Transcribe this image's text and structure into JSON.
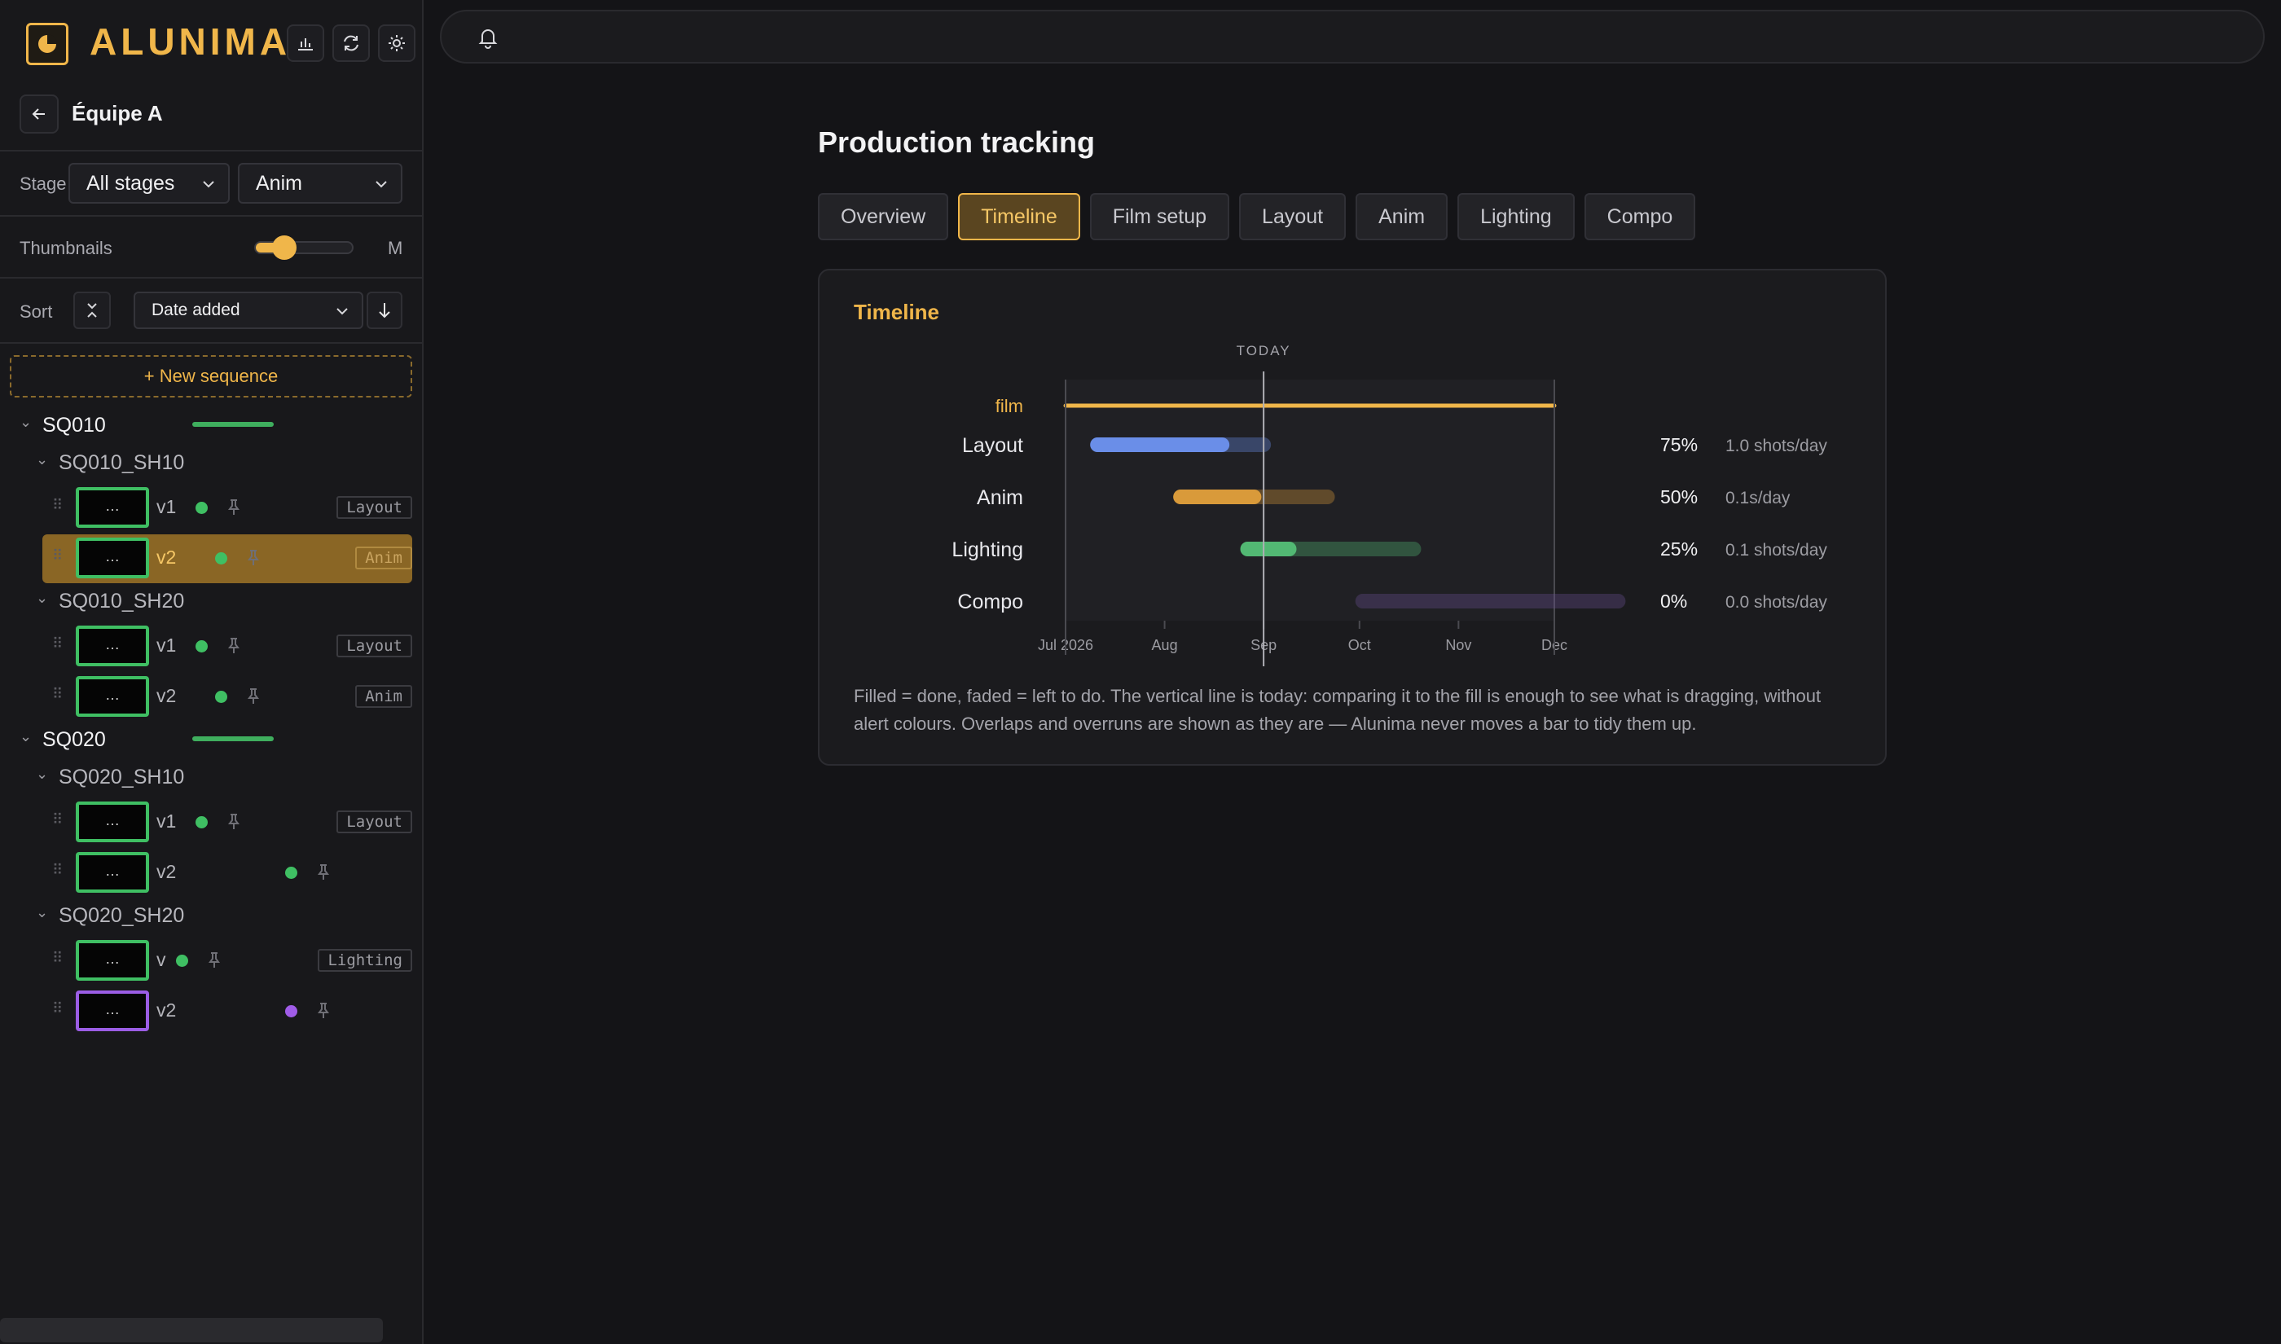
{
  "app": {
    "brand": "ALUNIMA"
  },
  "team": {
    "name": "Équipe A"
  },
  "filters": {
    "stage_label": "Stage",
    "stage_value": "All stages",
    "dept_value": "Anim"
  },
  "thumbnails": {
    "label": "Thumbnails",
    "size": "M",
    "slider_fraction": 0.3
  },
  "sort": {
    "label": "Sort",
    "value": "Date added"
  },
  "new_sequence": "+ New sequence",
  "tree": {
    "sequences": [
      {
        "name": "SQ010",
        "progress": 0.5,
        "shots": [
          {
            "name": "SQ010_SH10",
            "versions": [
              {
                "version": "v1",
                "stage": "Layout",
                "status": "green",
                "selected": false,
                "thumb": "…"
              },
              {
                "version": "v2",
                "stage": "Anim",
                "status": "green",
                "selected": true,
                "thumb": "…"
              }
            ]
          },
          {
            "name": "SQ010_SH20",
            "versions": [
              {
                "version": "v1",
                "stage": "Layout",
                "status": "green",
                "selected": false,
                "thumb": "…"
              },
              {
                "version": "v2",
                "stage": "Anim",
                "status": "green",
                "selected": false,
                "thumb": "…"
              }
            ]
          }
        ]
      },
      {
        "name": "SQ020",
        "progress": 0.5,
        "shots": [
          {
            "name": "SQ020_SH10",
            "versions": [
              {
                "version": "v1",
                "stage": "Layout",
                "status": "green",
                "selected": false,
                "thumb": "…"
              },
              {
                "version": "v2",
                "stage": "",
                "status": "green",
                "selected": false,
                "thumb": "…"
              }
            ]
          },
          {
            "name": "SQ020_SH20",
            "versions": [
              {
                "version": "v",
                "stage": "Lighting",
                "status": "green",
                "selected": false,
                "thumb": "…"
              },
              {
                "version": "v2",
                "stage": "",
                "status": "purple",
                "selected": false,
                "thumb": "…"
              }
            ]
          }
        ]
      }
    ]
  },
  "page": {
    "title": "Production tracking"
  },
  "tabs": [
    {
      "label": "Overview",
      "active": false
    },
    {
      "label": "Timeline",
      "active": true
    },
    {
      "label": "Film setup",
      "active": false
    },
    {
      "label": "Layout",
      "active": false
    },
    {
      "label": "Anim",
      "active": false
    },
    {
      "label": "Lighting",
      "active": false
    },
    {
      "label": "Compo",
      "active": false
    }
  ],
  "timeline": {
    "title": "Timeline",
    "today_label": "TODAY",
    "caption": "Filled = done, faded = left to do. The vertical line is today: comparing it to the fill is enough to see what is dragging, without alert colours. Overlaps and overruns are shown as they are — Alunima never moves a bar to tidy them up."
  },
  "chart_data": {
    "type": "gantt",
    "today": "2026-09-01",
    "film": {
      "label": "film",
      "start": "2026-07-01",
      "end": "2026-12-01",
      "color": "#f0b64a"
    },
    "x_ticks": [
      "Jul 2026",
      "Aug",
      "Sep",
      "Oct",
      "Nov",
      "Dec"
    ],
    "xlim": [
      "2026-07-01",
      "2026-12-01"
    ],
    "rows": [
      {
        "name": "Layout",
        "start": "2026-07-11",
        "end": "2026-09-01",
        "progress": 75,
        "rate": "1.0 shots/day",
        "color": "#6a8ee8"
      },
      {
        "name": "Anim",
        "start": "2026-08-06",
        "end": "2026-09-21",
        "progress": 50,
        "rate": "0.1s/day",
        "color": "#d99a3a"
      },
      {
        "name": "Lighting",
        "start": "2026-08-27",
        "end": "2026-10-18",
        "progress": 25,
        "rate": "0.1 shots/day",
        "color": "#52b873"
      },
      {
        "name": "Compo",
        "start": "2026-10-02",
        "end": "2026-12-21",
        "progress": 0,
        "rate": "0.0 shots/day",
        "color": "#6a4f93"
      }
    ]
  }
}
